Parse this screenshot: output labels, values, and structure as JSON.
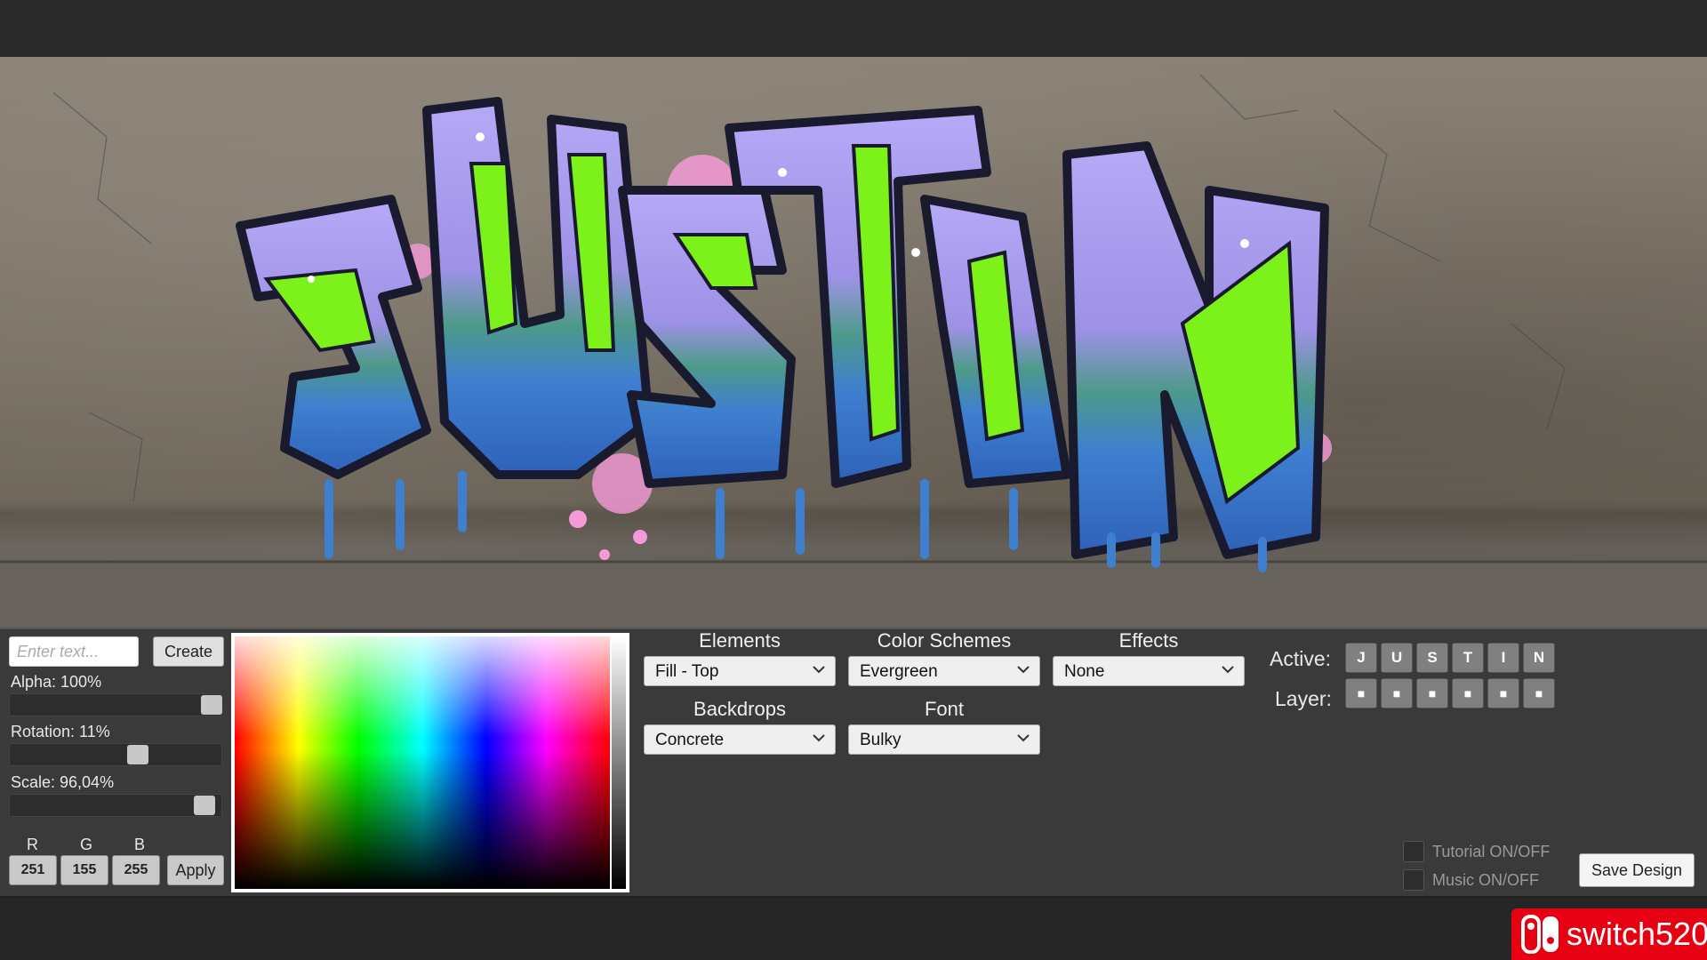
{
  "artwork": {
    "tag_text": "JUSTIN"
  },
  "left_controls": {
    "text_input_placeholder": "Enter text...",
    "create_label": "Create",
    "alpha_label": "Alpha: 100%",
    "alpha_value_percent": 100,
    "rotation_label": "Rotation: 11%",
    "rotation_value_percent": 11,
    "scale_label": "Scale: 96,04%",
    "scale_value_percent": 96.04,
    "r_label": "R",
    "g_label": "G",
    "b_label": "B",
    "r_value": "251",
    "g_value": "155",
    "b_value": "255",
    "apply_label": "Apply"
  },
  "dropdowns": {
    "elements": {
      "title": "Elements",
      "value": "Fill - Top"
    },
    "color_schemes": {
      "title": "Color Schemes",
      "value": "Evergreen"
    },
    "effects": {
      "title": "Effects",
      "value": "None"
    },
    "backdrops": {
      "title": "Backdrops",
      "value": "Concrete"
    },
    "font": {
      "title": "Font",
      "value": "Bulky"
    }
  },
  "letters": {
    "active_label": "Active:",
    "layer_label": "Layer:",
    "active": [
      "J",
      "U",
      "S",
      "T",
      "I",
      "N"
    ],
    "layer": [
      "■",
      "■",
      "■",
      "■",
      "■",
      "■"
    ]
  },
  "toggles": {
    "tutorial_label": "Tutorial ON/OFF",
    "music_label": "Music ON/OFF"
  },
  "save_label": "Save Design",
  "watermark": {
    "text": "switch520"
  },
  "colors": {
    "graffiti_fill": "#a99cf0",
    "graffiti_accent": "#7cf21a",
    "graffiti_lower": "#3f7fd0",
    "graffiti_outline": "#1a1a2e",
    "splatter": "#f59ad8",
    "panel_bg": "#3a3a3a",
    "badge_red": "#e60012"
  }
}
